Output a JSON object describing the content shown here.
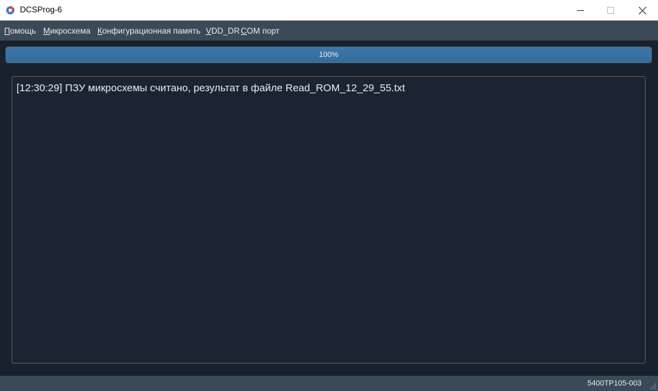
{
  "window": {
    "title": "DCSProg-6",
    "icon": "app-logo-icon",
    "controls": [
      "minimize-icon",
      "maximize-icon",
      "close-icon"
    ]
  },
  "menu": {
    "items": [
      {
        "mnemonic": "П",
        "rest": "омощь"
      },
      {
        "mnemonic": "М",
        "rest": "икросхема"
      },
      {
        "mnemonic": "К",
        "rest": "онфигурационная память"
      },
      {
        "mnemonic": "V",
        "rest": "DD_DR"
      },
      {
        "mnemonic": "C",
        "rest": "OM порт"
      }
    ]
  },
  "progress": {
    "value": 1.0,
    "label": "100%"
  },
  "log": {
    "lines": [
      "[12:30:29] ПЗУ микросхемы считано, результат в файле Read_ROM_12_29_55.txt"
    ]
  },
  "status": {
    "device": "5400TP105-003"
  }
}
